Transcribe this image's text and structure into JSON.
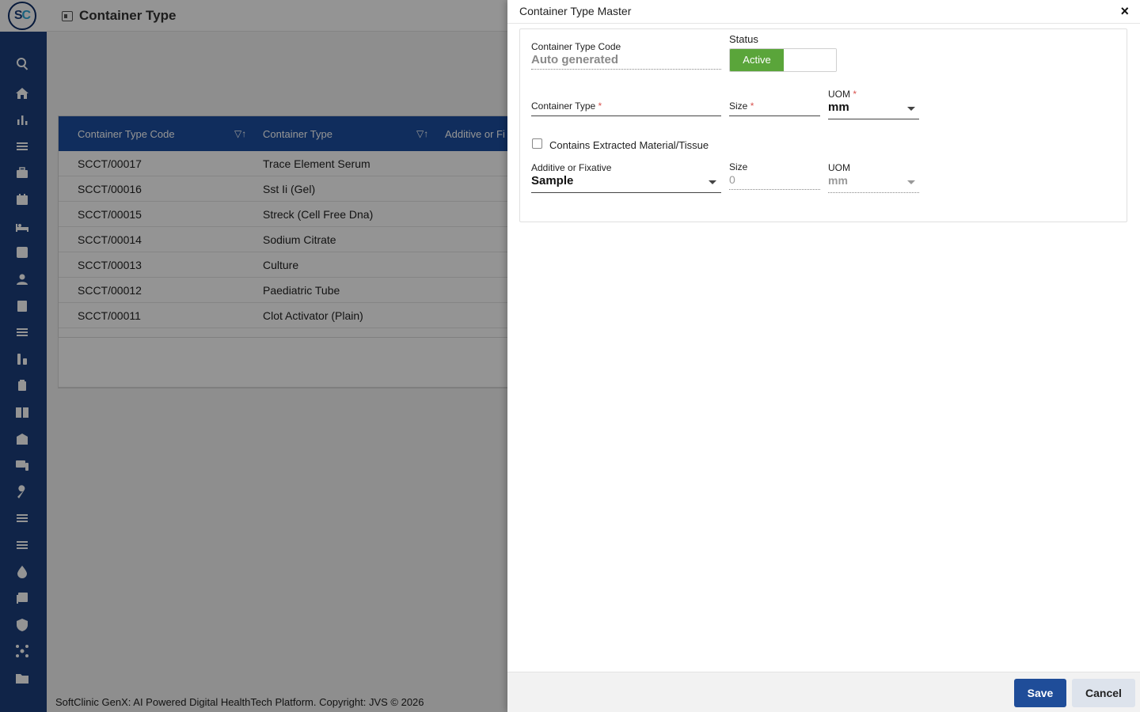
{
  "app": {
    "logo_text_s": "S",
    "logo_text_c": "C",
    "page_title": "Container Type"
  },
  "sidebar": {
    "icons": [
      "search-icon",
      "home-icon",
      "bar-chart-icon",
      "menu-icon",
      "briefcase-medical-icon",
      "calendar-icon",
      "bed-icon",
      "plus-square-icon",
      "user-icon",
      "list-icon",
      "menu-icon",
      "lab-icon",
      "medicine-icon",
      "book-icon",
      "building-icon",
      "devices-icon",
      "wrench-icon",
      "menu-icon",
      "menu-icon",
      "drop-icon",
      "add-document-icon",
      "shield-icon",
      "network-icon",
      "folder-icon"
    ]
  },
  "grid": {
    "columns": [
      "Container Type Code",
      "Container Type",
      "Additive or Fi"
    ],
    "rows": [
      {
        "code": "SCCT/00017",
        "type": "Trace Element Serum"
      },
      {
        "code": "SCCT/00016",
        "type": "Sst Ii (Gel)"
      },
      {
        "code": "SCCT/00015",
        "type": "Streck (Cell Free Dna)"
      },
      {
        "code": "SCCT/00014",
        "type": "Sodium Citrate"
      },
      {
        "code": "SCCT/00013",
        "type": "Culture"
      },
      {
        "code": "SCCT/00012",
        "type": "Paediatric Tube"
      },
      {
        "code": "SCCT/00011",
        "type": "Clot Activator (Plain)"
      }
    ]
  },
  "footer": {
    "text": "SoftClinic GenX: AI Powered Digital HealthTech Platform. Copyright: JVS © 2026"
  },
  "modal": {
    "title": "Container Type Master",
    "close_label": "×",
    "code_label": "Container Type Code",
    "code_value": "Auto generated",
    "status_label": "Status",
    "status_active": "Active",
    "container_type_label": "Container Type",
    "required_mark": "*",
    "size_label": "Size",
    "uom_label": "UOM",
    "uom_value": "mm",
    "checkbox_label": "Contains Extracted Material/Tissue",
    "additive_label": "Additive or Fixative",
    "additive_value": "Sample",
    "size2_label": "Size",
    "size2_value": "0",
    "uom2_label": "UOM",
    "uom2_value": "mm",
    "save_label": "Save",
    "cancel_label": "Cancel"
  }
}
